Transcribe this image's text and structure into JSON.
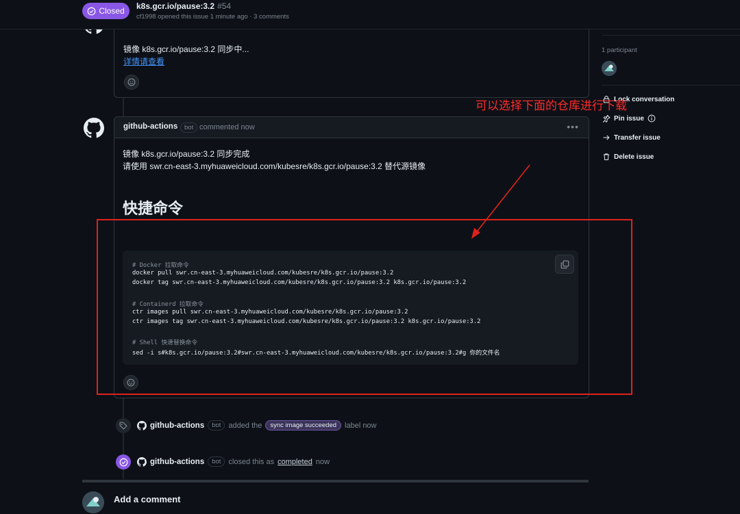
{
  "header": {
    "state": "Closed",
    "title": "k8s.gcr.io/pause:3.2",
    "number": "#54",
    "meta": "cf1998 opened this issue 1 minute ago · 3 comments"
  },
  "comment1": {
    "line1": "镜像 k8s.gcr.io/pause:3.2 同步中...",
    "link": "详情请查看"
  },
  "comment2": {
    "author": "github-actions",
    "bot": "bot",
    "time": "commented now",
    "line1": "镜像 k8s.gcr.io/pause:3.2 同步完成",
    "line2": "请使用 swr.cn-east-3.myhuaweicloud.com/kubesre/k8s.gcr.io/pause:3.2 替代源镜像",
    "heading": "快捷命令",
    "code": {
      "c1": "# Docker 拉取命令",
      "l1": "docker pull swr.cn-east-3.myhuaweicloud.com/kubesre/k8s.gcr.io/pause:3.2",
      "l2": "docker tag swr.cn-east-3.myhuaweicloud.com/kubesre/k8s.gcr.io/pause:3.2 k8s.gcr.io/pause:3.2",
      "c2": "# Containerd 拉取命令",
      "l3": "ctr images pull swr.cn-east-3.myhuaweicloud.com/kubesre/k8s.gcr.io/pause:3.2",
      "l4": "ctr images tag swr.cn-east-3.myhuaweicloud.com/kubesre/k8s.gcr.io/pause:3.2 k8s.gcr.io/pause:3.2",
      "c3": "# Shell 快速替换命令",
      "l5": "sed -i s#k8s.gcr.io/pause:3.2#swr.cn-east-3.myhuaweicloud.com/kubesre/k8s.gcr.io/pause:3.2#g 你的文件名"
    }
  },
  "events": [
    {
      "author": "github-actions",
      "bot": "bot",
      "pre": "added the",
      "label": "sync image succeeded",
      "post": "label now"
    },
    {
      "author": "github-actions",
      "bot": "bot",
      "pre": "closed this as",
      "link": "completed",
      "post": "now"
    }
  ],
  "add_comment": "Add a comment",
  "sidebar": {
    "participants": "1 participant",
    "lock": "Lock conversation",
    "pin": "Pin issue",
    "transfer": "Transfer issue",
    "delete": "Delete issue"
  },
  "annotation": {
    "text": "可以选择下面的仓库进行下载"
  },
  "colors": {
    "closed_badge": "#8957e5",
    "annotation_red": "#e0211b",
    "link": "#4493f8",
    "background": "#0d1117"
  }
}
